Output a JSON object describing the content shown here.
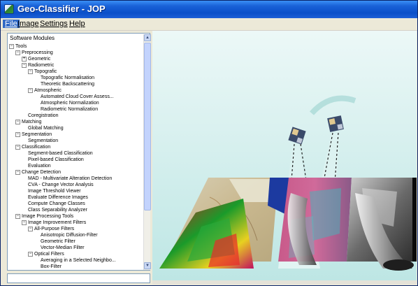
{
  "window": {
    "title": "Geo-Classifier - JOP"
  },
  "menu": [
    {
      "label": "File",
      "selected": true
    },
    {
      "label": "Image",
      "selected": false
    },
    {
      "label": "Settings",
      "selected": false
    },
    {
      "label": "Help",
      "selected": false
    }
  ],
  "panel": {
    "title": "Software Modules"
  },
  "tree": [
    {
      "label": "Tools",
      "level": 0,
      "toggle": "-"
    },
    {
      "label": "Preprocessing",
      "level": 1,
      "toggle": "-"
    },
    {
      "label": "Geometric",
      "level": 2,
      "toggle": "+"
    },
    {
      "label": "Radiometric",
      "level": 2,
      "toggle": "-"
    },
    {
      "label": "Topografic",
      "level": 3,
      "toggle": "-"
    },
    {
      "label": "Topografic Normalisation",
      "level": 4,
      "toggle": ""
    },
    {
      "label": "Theoretic Backscattering",
      "level": 4,
      "toggle": ""
    },
    {
      "label": "Atmospheric",
      "level": 3,
      "toggle": "-"
    },
    {
      "label": "Automated Cloud Cover Assess...",
      "level": 4,
      "toggle": ""
    },
    {
      "label": "Atmospheric Normalization",
      "level": 4,
      "toggle": ""
    },
    {
      "label": "Radiometric Normalization",
      "level": 4,
      "toggle": ""
    },
    {
      "label": "Coregistration",
      "level": 2,
      "toggle": ""
    },
    {
      "label": "Matching",
      "level": 1,
      "toggle": "-"
    },
    {
      "label": "Global Matching",
      "level": 2,
      "toggle": ""
    },
    {
      "label": "Segmentation",
      "level": 1,
      "toggle": "-"
    },
    {
      "label": "Segmentation",
      "level": 2,
      "toggle": ""
    },
    {
      "label": "Classification",
      "level": 1,
      "toggle": "-"
    },
    {
      "label": "Segment-based Classification",
      "level": 2,
      "toggle": ""
    },
    {
      "label": "Pixel-based Classification",
      "level": 2,
      "toggle": ""
    },
    {
      "label": "Evaluation",
      "level": 2,
      "toggle": ""
    },
    {
      "label": "Change Detection",
      "level": 1,
      "toggle": "-"
    },
    {
      "label": "MAD - Multivariate Alteration Detection",
      "level": 2,
      "toggle": ""
    },
    {
      "label": "CVA - Change Vector Analysis",
      "level": 2,
      "toggle": ""
    },
    {
      "label": "Image Threshold Viewer",
      "level": 2,
      "toggle": ""
    },
    {
      "label": "Evaluate Difference Images",
      "level": 2,
      "toggle": ""
    },
    {
      "label": "Compute Change Classes",
      "level": 2,
      "toggle": ""
    },
    {
      "label": "Class Separability Analyzer",
      "level": 2,
      "toggle": ""
    },
    {
      "label": "Image Processing Tools",
      "level": 1,
      "toggle": "-"
    },
    {
      "label": "Image Improvement Filters",
      "level": 2,
      "toggle": "-"
    },
    {
      "label": "All-Purpose Filters",
      "level": 3,
      "toggle": "-"
    },
    {
      "label": "Anisotropic Diffusion-Filter",
      "level": 4,
      "toggle": ""
    },
    {
      "label": "Geometric Filter",
      "level": 4,
      "toggle": ""
    },
    {
      "label": "Vector-Median Filter",
      "level": 4,
      "toggle": ""
    },
    {
      "label": "Optical Filters",
      "level": 3,
      "toggle": "-"
    },
    {
      "label": "Averaging in a Selected Neighbo...",
      "level": 4,
      "toggle": ""
    },
    {
      "label": "Box-Filter",
      "level": 4,
      "toggle": ""
    }
  ],
  "colors": {
    "titlebar": "#0a4fc9",
    "menu_selection": "#316ac5",
    "viewport_background": "#c6ebea"
  },
  "icons": {
    "scroll_up": "scroll-up-arrow-icon",
    "scroll_down": "scroll-down-arrow-icon",
    "app": "app-icon"
  }
}
